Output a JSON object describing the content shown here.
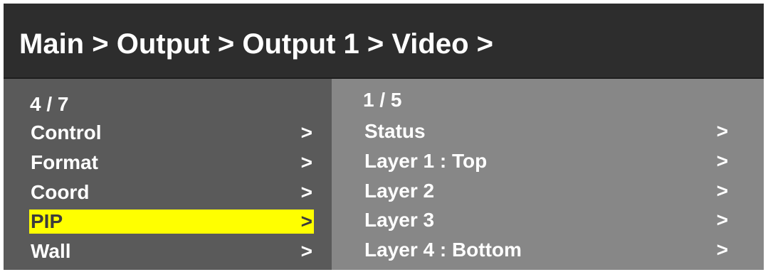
{
  "header": {
    "breadcrumb": "Main > Output > Output 1 > Video >"
  },
  "left_menu": {
    "counter": "4 / 7",
    "items": [
      {
        "label": "Control",
        "arrow": ">"
      },
      {
        "label": "Format",
        "arrow": ">"
      },
      {
        "label": "Coord",
        "arrow": ">"
      },
      {
        "label": "PIP",
        "arrow": ">",
        "selected": true
      },
      {
        "label": "Wall",
        "arrow": ">"
      }
    ]
  },
  "right_menu": {
    "counter": "1 / 5",
    "items": [
      {
        "label": "Status",
        "arrow": ">"
      },
      {
        "label": "Layer 1 : Top",
        "arrow": ">"
      },
      {
        "label": "Layer 2",
        "arrow": ">"
      },
      {
        "label": "Layer 3",
        "arrow": ">"
      },
      {
        "label": "Layer 4 : Bottom",
        "arrow": ">"
      }
    ]
  },
  "colors": {
    "header_bg": "#2d2d2d",
    "left_panel_bg": "#5a5a5a",
    "right_panel_bg": "#878787",
    "highlight": "#ffff00",
    "text": "#ffffff"
  }
}
